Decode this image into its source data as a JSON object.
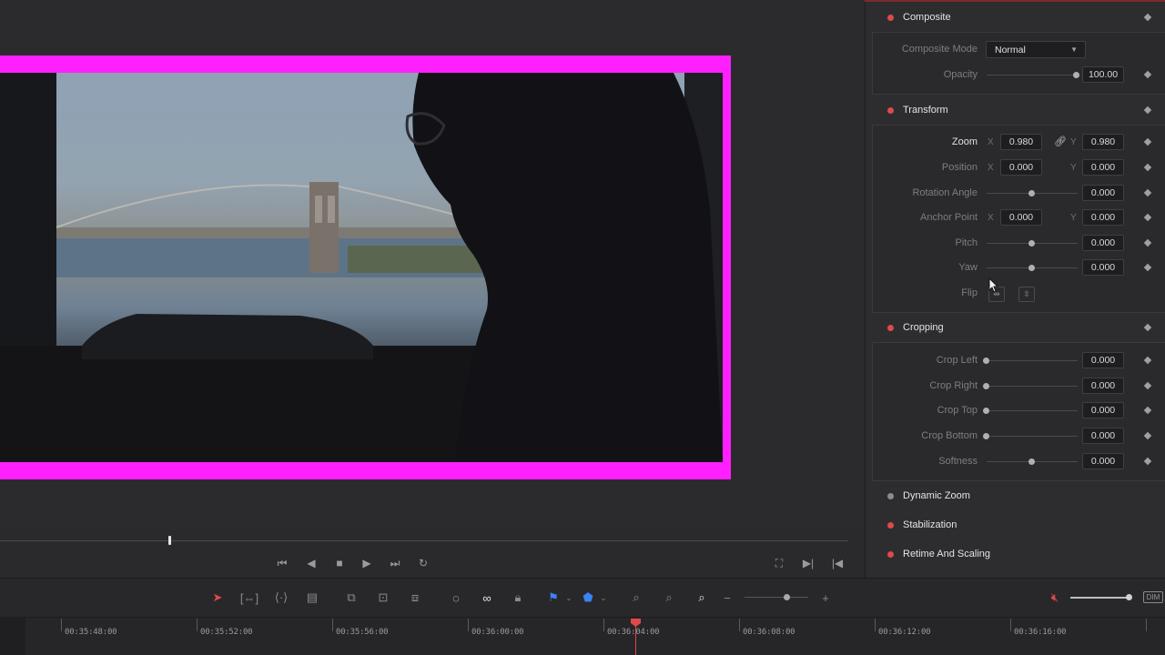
{
  "viewer": {},
  "transport": {
    "buttons": [
      "first-frame",
      "play-reverse",
      "stop",
      "play",
      "last-frame",
      "loop"
    ],
    "right_buttons": [
      "match-frame",
      "next-edit",
      "prev-edit"
    ]
  },
  "toolbar": {
    "tools": [
      "selection",
      "trim",
      "dynamic-trim",
      "blade",
      "insert",
      "overwrite",
      "replace",
      "snapping",
      "linked-selection",
      "position-lock",
      "flag",
      "marker",
      "zoom-full",
      "zoom-detail",
      "zoom-custom"
    ],
    "zoom_minus": "−",
    "zoom_plus": "+",
    "dim_label": "DIM"
  },
  "timeline": {
    "timecodes": [
      "00:35:48:00",
      "00:35:52:00",
      "00:35:56:00",
      "00:36:00:00",
      "00:36:04:00",
      "00:36:08:00",
      "00:36:12:00",
      "00:36:16:00"
    ]
  },
  "inspector": {
    "composite": {
      "title": "Composite",
      "mode_label": "Composite Mode",
      "mode_value": "Normal",
      "opacity_label": "Opacity",
      "opacity_value": "100.00"
    },
    "transform": {
      "title": "Transform",
      "zoom_label": "Zoom",
      "zoom_x": "0.980",
      "zoom_y": "0.980",
      "position_label": "Position",
      "position_x": "0.000",
      "position_y": "0.000",
      "rotation_label": "Rotation Angle",
      "rotation_value": "0.000",
      "anchor_label": "Anchor Point",
      "anchor_x": "0.000",
      "anchor_y": "0.000",
      "pitch_label": "Pitch",
      "pitch_value": "0.000",
      "yaw_label": "Yaw",
      "yaw_value": "0.000",
      "flip_label": "Flip",
      "x_axis": "X",
      "y_axis": "Y"
    },
    "cropping": {
      "title": "Cropping",
      "crop_left_label": "Crop Left",
      "crop_left": "0.000",
      "crop_right_label": "Crop Right",
      "crop_right": "0.000",
      "crop_top_label": "Crop Top",
      "crop_top": "0.000",
      "crop_bottom_label": "Crop Bottom",
      "crop_bottom": "0.000",
      "softness_label": "Softness",
      "softness": "0.000"
    },
    "dynamic_zoom": {
      "title": "Dynamic Zoom"
    },
    "stabilization": {
      "title": "Stabilization"
    },
    "retime": {
      "title": "Retime And Scaling"
    }
  },
  "colors": {
    "accent_red": "#e0494a",
    "frame_border": "#ff1fff",
    "panel_bg": "#2d2d2f"
  }
}
